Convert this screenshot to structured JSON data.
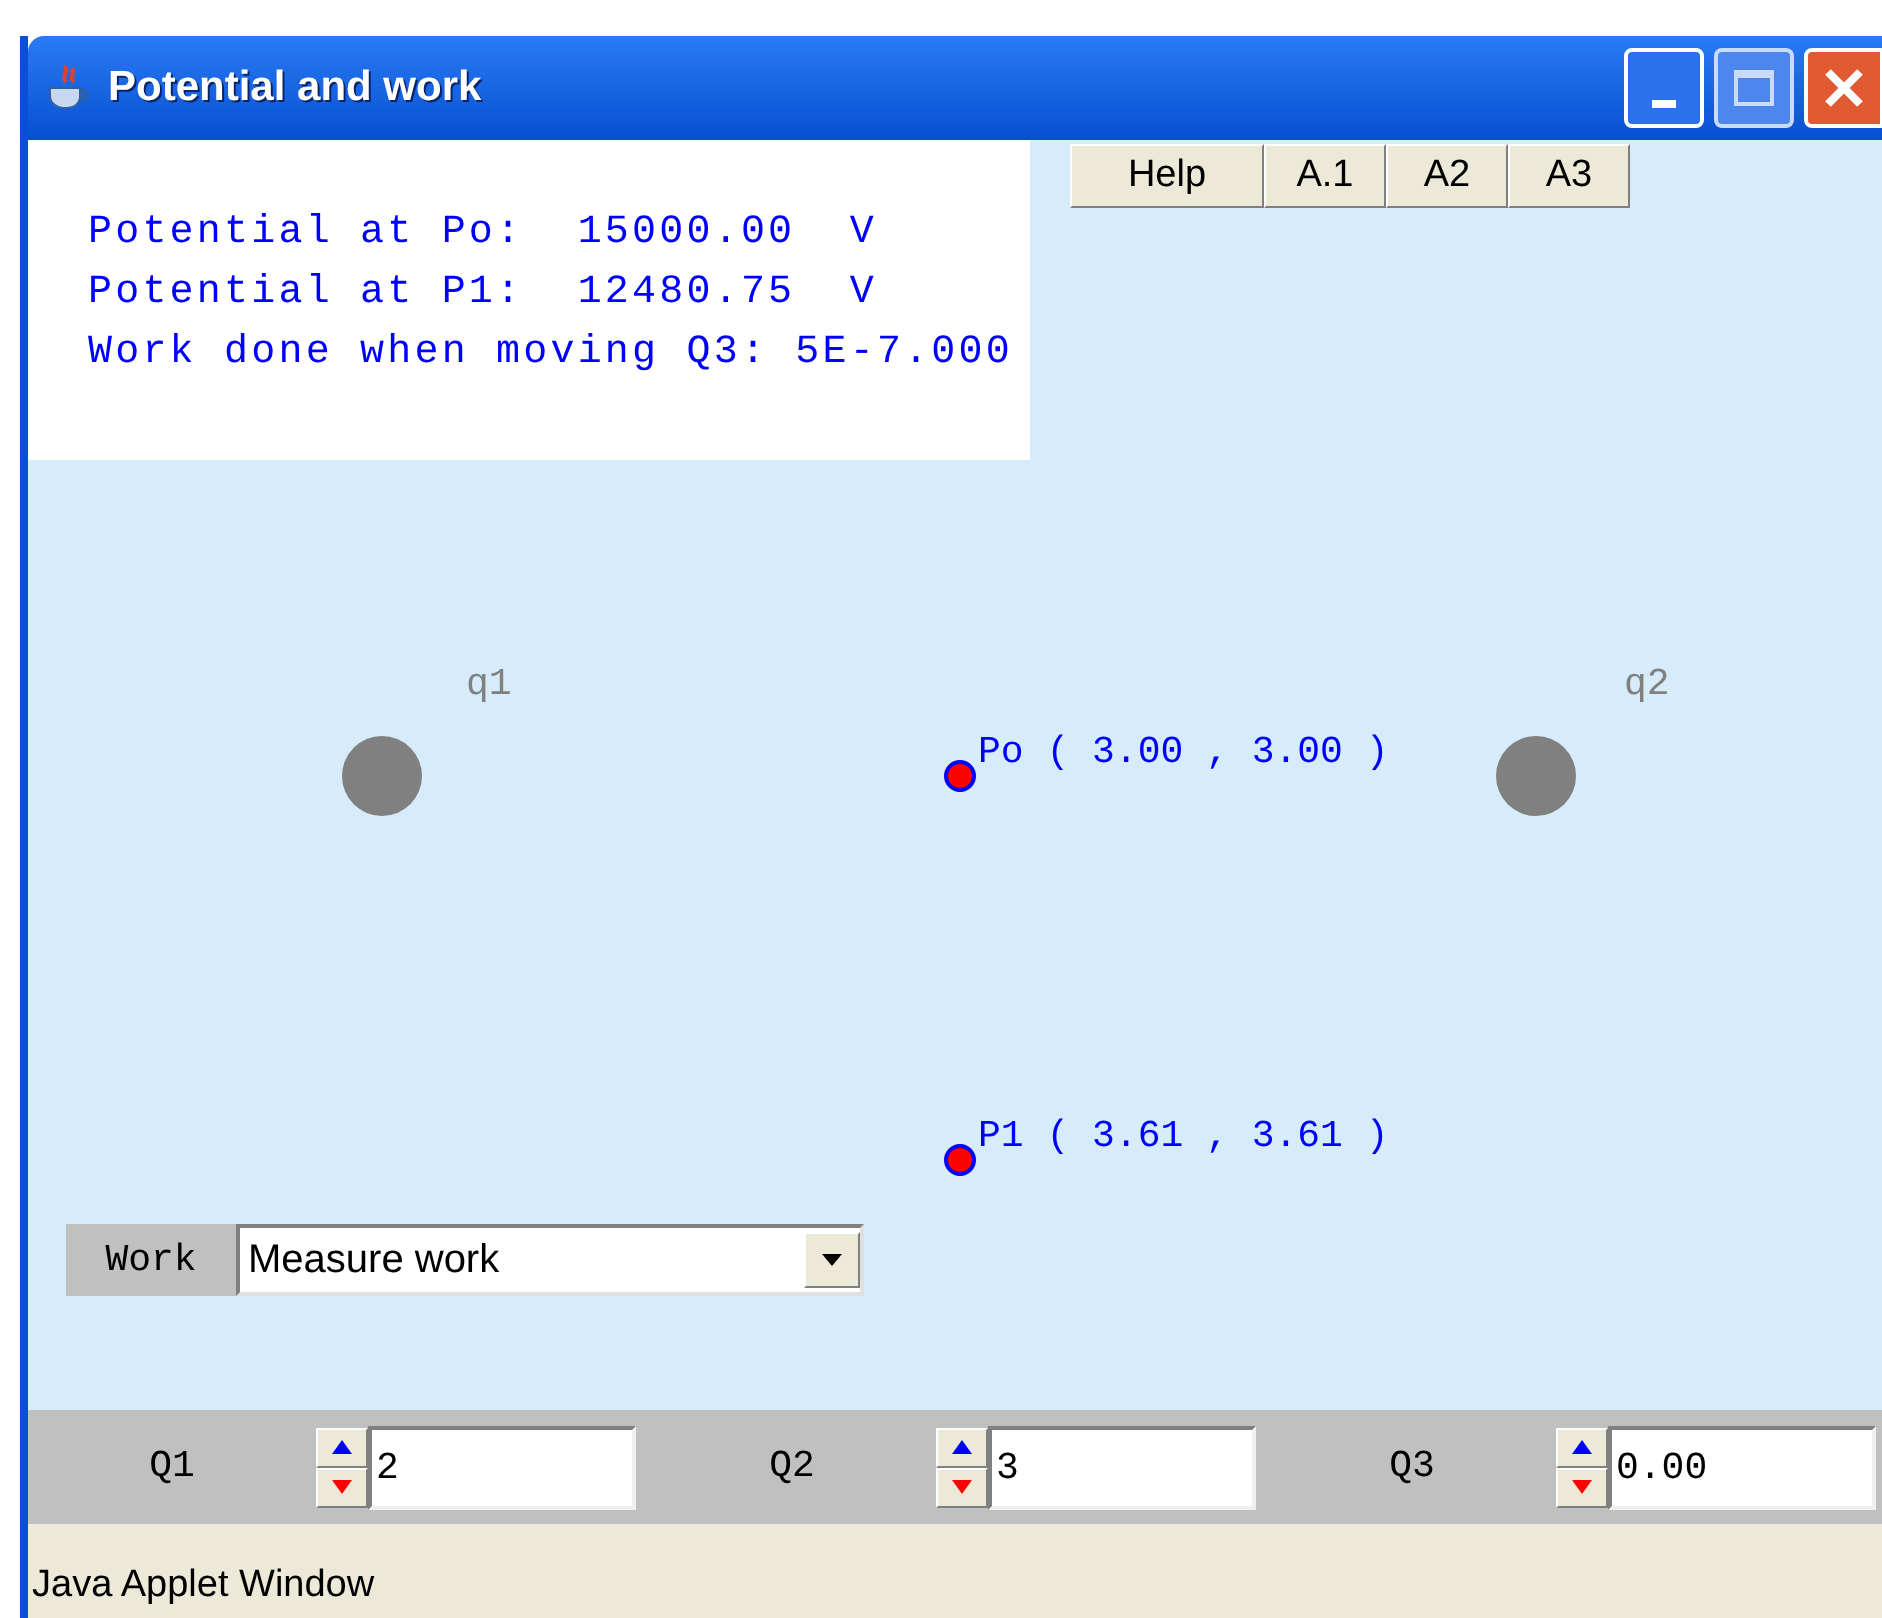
{
  "window": {
    "title": "Potential and work"
  },
  "toolbar_buttons": [
    {
      "label": "Help"
    },
    {
      "label": "A.1"
    },
    {
      "label": "A2"
    },
    {
      "label": "A3"
    }
  ],
  "readouts": [
    "Potential at Po:  15000.00  V",
    "Potential at P1:  12480.75  V",
    "Work done when moving Q3: 5E-7.000"
  ],
  "charges": [
    {
      "label": "q1"
    },
    {
      "label": "q2"
    }
  ],
  "points": [
    {
      "label": "Po ( 3.00 , 3.00 )"
    },
    {
      "label": "P1 ( 3.61 , 3.61 )"
    }
  ],
  "work_select": {
    "label": "Work",
    "value": "Measure work"
  },
  "spinners": [
    {
      "label": "Q1",
      "value": "2"
    },
    {
      "label": "Q2",
      "value": "3"
    },
    {
      "label": "Q3",
      "value": "0.00"
    }
  ],
  "status_bar": "Java Applet Window"
}
